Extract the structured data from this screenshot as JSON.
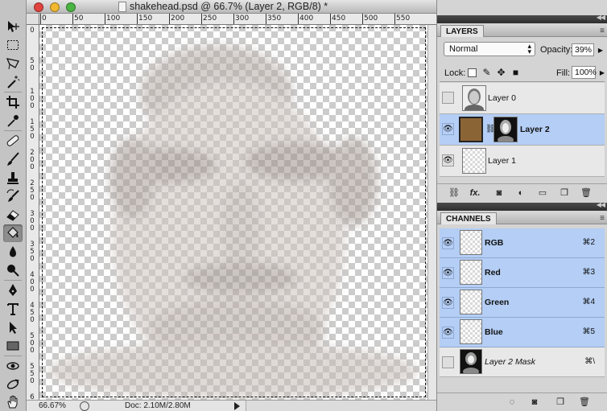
{
  "document": {
    "title": "shakehead.psd @ 66.7% (Layer 2, RGB/8) *",
    "zoom": "66.67%",
    "doc_size": "Doc: 2.10M/2.80M",
    "ruler_top_labels": [
      "0",
      "50",
      "100",
      "150",
      "200",
      "250",
      "300",
      "350",
      "400",
      "450",
      "500",
      "550"
    ],
    "ruler_left_labels": [
      "0",
      "50",
      "100",
      "150",
      "200",
      "250",
      "300",
      "350",
      "400",
      "450",
      "500",
      "550",
      "600"
    ]
  },
  "tools": {
    "items": [
      "move-tool",
      "marquee-tool",
      "lasso-tool",
      "quick-select-tool",
      "crop-tool",
      "eyedropper-tool",
      "healing-brush-tool",
      "brush-tool",
      "clone-stamp-tool",
      "history-brush-tool",
      "eraser-tool",
      "paint-bucket-tool",
      "blur-tool",
      "dodge-tool",
      "pen-tool",
      "type-tool",
      "path-selection-tool",
      "rectangle-tool",
      "3d-rotate-tool",
      "3d-orbit-tool",
      "hand-tool"
    ],
    "active": "paint-bucket-tool"
  },
  "layers_panel": {
    "tab": "LAYERS",
    "menu_icon": "≡",
    "blend_mode": "Normal",
    "opacity_label": "Opacity:",
    "opacity": "39%",
    "lock_label": "Lock:",
    "fill_label": "Fill:",
    "fill": "100%",
    "layers": [
      {
        "name": "Layer 0",
        "visible": false,
        "selected": false
      },
      {
        "name": "Layer 2",
        "visible": true,
        "selected": true
      },
      {
        "name": "Layer 1",
        "visible": true,
        "selected": false
      }
    ],
    "footer_icons": [
      "link-icon",
      "fx-icon",
      "mask-icon",
      "adjustment-icon",
      "folder-icon",
      "new-layer-icon",
      "trash-icon"
    ],
    "fx_label": "fx."
  },
  "channels_panel": {
    "tab": "CHANNELS",
    "menu_icon": "≡",
    "channels": [
      {
        "name": "RGB",
        "shortcut": "⌘2",
        "visible": true
      },
      {
        "name": "Red",
        "shortcut": "⌘3",
        "visible": true
      },
      {
        "name": "Green",
        "shortcut": "⌘4",
        "visible": true
      },
      {
        "name": "Blue",
        "shortcut": "⌘5",
        "visible": true
      },
      {
        "name": "Layer 2 Mask",
        "shortcut": "⌘\\",
        "visible": false
      }
    ],
    "footer_icons": [
      "load-selection-icon",
      "save-selection-icon",
      "new-channel-icon",
      "trash-icon"
    ]
  },
  "colors": {
    "selection": "#b4cef5",
    "layer2_fill": "#8b6436",
    "close": "#e0443e",
    "minimize": "#f1b830",
    "zoom": "#4bb543"
  }
}
